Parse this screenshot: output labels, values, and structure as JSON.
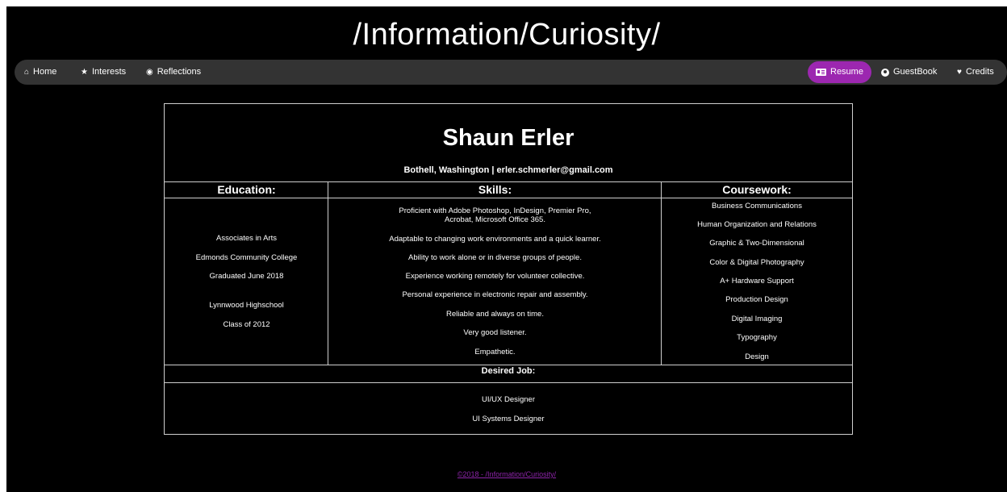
{
  "site": {
    "title": "/Information/Curiosity/"
  },
  "nav": {
    "left": [
      {
        "label": "Home",
        "icon": "home-icon"
      },
      {
        "label": "Interests",
        "icon": "star-icon"
      },
      {
        "label": "Reflections",
        "icon": "eye-icon"
      }
    ],
    "right": [
      {
        "label": "Resume",
        "icon": "id-card-icon",
        "active": true
      },
      {
        "label": "GuestBook",
        "icon": "user-circle-icon"
      },
      {
        "label": "Credits",
        "icon": "heart-icon"
      }
    ],
    "active_color": "#9c27b0"
  },
  "resume": {
    "name": "Shaun Erler",
    "contact": "Bothell, Washington | erler.schmerler@gmail.com",
    "education": {
      "heading": "Education:",
      "items": [
        "Associates in Arts",
        "Edmonds Community College",
        "Graduated June 2018",
        "Lynnwood Highschool",
        "Class of 2012"
      ]
    },
    "skills": {
      "heading": "Skills:",
      "items": [
        "Proficient with Adobe Photoshop, InDesign, Premier Pro,",
        "Acrobat, Microsoft Office 365.",
        "Adaptable to changing work environments and a quick learner.",
        "Ability to work alone or in diverse groups of people.",
        "Experience working remotely for volunteer collective.",
        "Personal experience in electronic repair and assembly.",
        "Reliable and always on time.",
        "Very good listener.",
        "Empathetic."
      ]
    },
    "coursework": {
      "heading": "Coursework:",
      "items": [
        "Business Communications",
        "Human Organization and Relations",
        "Graphic & Two-Dimensional",
        "Color & Digital Photography",
        "A+ Hardware Support",
        "Production Design",
        "Digital Imaging",
        "Typography",
        "Design"
      ]
    },
    "desired_job": {
      "heading": "Desired Job:",
      "items": [
        "UI/UX Designer",
        "UI Systems Designer"
      ]
    }
  },
  "footer": {
    "text": "©2018 - /Information/Curiosity/"
  }
}
